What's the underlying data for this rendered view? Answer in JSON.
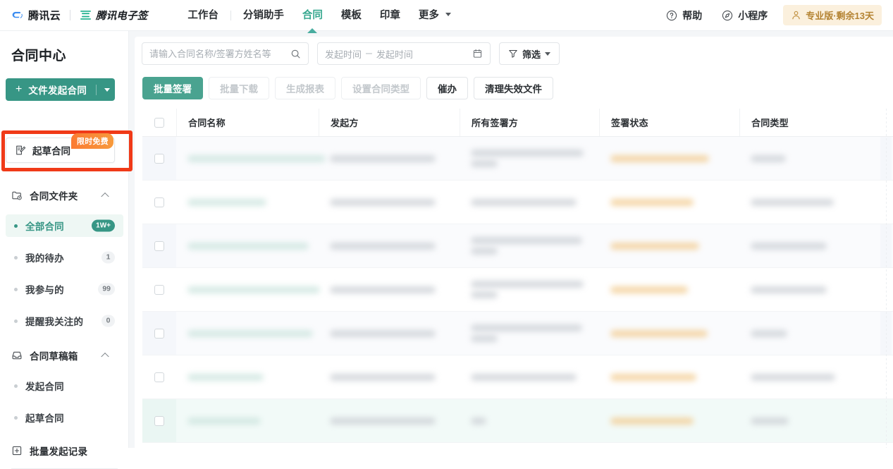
{
  "topnav": {
    "brand_cloud": "腾讯云",
    "brand_esign": "腾讯电子签",
    "items": [
      {
        "label": "工作台",
        "active": false
      },
      {
        "label": "分销助手",
        "active": false
      },
      {
        "label": "合同",
        "active": true
      },
      {
        "label": "模板",
        "active": false
      },
      {
        "label": "印章",
        "active": false
      },
      {
        "label": "更多",
        "active": false,
        "has_caret": true
      }
    ],
    "help_label": "帮助",
    "miniprogram_label": "小程序",
    "pro_badge": "专业版·剩余13天"
  },
  "sidebar": {
    "title": "合同中心",
    "primary_button": "文件发起合同",
    "draft_button": "起草合同",
    "free_badge": "限时免费",
    "groups": [
      {
        "label": "合同文件夹",
        "icon": "folder-icon",
        "items": [
          {
            "label": "全部合同",
            "count": "1W+",
            "active": true
          },
          {
            "label": "我的待办",
            "count": "1",
            "active": false
          },
          {
            "label": "我参与的",
            "count": "99",
            "active": false
          },
          {
            "label": "提醒我关注的",
            "count": "0",
            "active": false
          }
        ]
      },
      {
        "label": "合同草稿箱",
        "icon": "inbox-icon",
        "items": [
          {
            "label": "发起合同",
            "count": "",
            "active": false
          },
          {
            "label": "起草合同",
            "count": "",
            "active": false
          }
        ]
      }
    ],
    "batch_record": "批量发起记录"
  },
  "toolbar": {
    "search_placeholder": "请输入合同名称/签署方姓名等",
    "search_value": "",
    "date_start_placeholder": "发起时间",
    "date_end_placeholder": "发起时间",
    "date_separator": "–",
    "filter_label": "筛选"
  },
  "actions": [
    {
      "label": "批量签署",
      "state": "primary"
    },
    {
      "label": "批量下载",
      "state": "disabled"
    },
    {
      "label": "生成报表",
      "state": "disabled"
    },
    {
      "label": "设置合同类型",
      "state": "disabled"
    },
    {
      "label": "催办",
      "state": "normal"
    },
    {
      "label": "清理失效文件",
      "state": "normal"
    }
  ],
  "table": {
    "columns": [
      "合同名称",
      "发起方",
      "所有签署方",
      "签署状态",
      "合同类型"
    ],
    "rows": [
      {
        "style": "alt",
        "name_w": [
          196
        ],
        "from_w": [
          150
        ],
        "all_w": [
          160,
          38
        ],
        "state_w": [
          140
        ],
        "type_w": [
          50
        ]
      },
      {
        "style": "plain",
        "name_w": [
          112
        ],
        "from_w": [
          150
        ],
        "all_w": [
          150
        ],
        "state_w": [
          118
        ],
        "type_w": [
          118
        ]
      },
      {
        "style": "alt",
        "name_w": [
          172
        ],
        "from_w": [
          150
        ],
        "all_w": [
          158,
          38
        ],
        "state_w": [
          126
        ],
        "type_w": [
          108
        ]
      },
      {
        "style": "plain",
        "name_w": [
          188
        ],
        "from_w": [
          150
        ],
        "all_w": [
          160,
          38
        ],
        "state_w": [
          110
        ],
        "type_w": [
          108
        ]
      },
      {
        "style": "alt",
        "name_w": [
          178
        ],
        "from_w": [
          150
        ],
        "all_w": [
          158,
          38
        ],
        "state_w": [
          138
        ],
        "type_w": [
          52
        ]
      },
      {
        "style": "plain",
        "name_w": [
          108
        ],
        "from_w": [
          150
        ],
        "all_w": [
          150
        ],
        "state_w": [
          122
        ],
        "type_w": [
          120
        ]
      },
      {
        "style": "hover",
        "name_w": [
          104
        ],
        "from_w": [
          150
        ],
        "all_w": [
          22
        ],
        "state_w": [
          118
        ],
        "type_w": [
          54
        ]
      }
    ]
  }
}
